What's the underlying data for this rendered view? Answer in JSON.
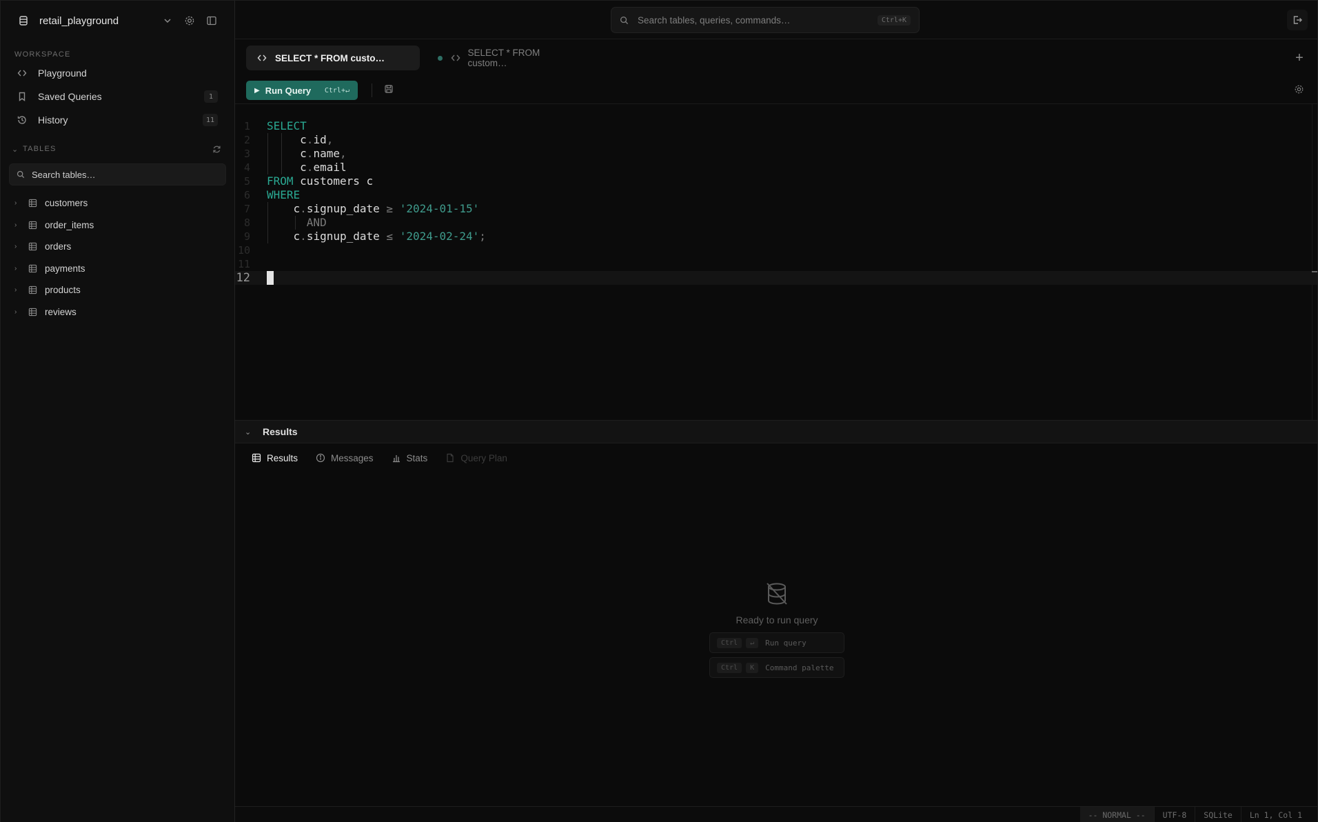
{
  "sidebar": {
    "database_name": "retail_playground",
    "workspace_label": "WORKSPACE",
    "nav": [
      {
        "label": "Playground",
        "badge": ""
      },
      {
        "label": "Saved Queries",
        "badge": "1"
      },
      {
        "label": "History",
        "badge": "11"
      }
    ],
    "tables_label": "TABLES",
    "table_search_placeholder": "Search tables…",
    "tables": [
      "customers",
      "order_items",
      "orders",
      "payments",
      "products",
      "reviews"
    ]
  },
  "topbar": {
    "search_placeholder": "Search tables, queries, commands…",
    "search_shortcut": "Ctrl+K"
  },
  "tabs": [
    {
      "label": "SELECT * FROM custo…",
      "active": true
    },
    {
      "label": "SELECT * FROM custom…",
      "active": false,
      "unsaved": true
    }
  ],
  "toolbar": {
    "run_label": "Run Query",
    "run_shortcut": "Ctrl+↵"
  },
  "editor": {
    "lines": [
      {
        "n": "1",
        "tokens": [
          {
            "t": "SELECT",
            "c": "kw"
          }
        ]
      },
      {
        "n": "2",
        "tokens": [
          {
            "t": "     c",
            "c": ""
          },
          {
            "t": ".",
            "c": "op"
          },
          {
            "t": "id",
            "c": ""
          },
          {
            "t": ",",
            "c": "op"
          }
        ]
      },
      {
        "n": "3",
        "tokens": [
          {
            "t": "     c",
            "c": ""
          },
          {
            "t": ".",
            "c": "op"
          },
          {
            "t": "name",
            "c": ""
          },
          {
            "t": ",",
            "c": "op"
          }
        ]
      },
      {
        "n": "4",
        "tokens": [
          {
            "t": "     c",
            "c": ""
          },
          {
            "t": ".",
            "c": "op"
          },
          {
            "t": "email",
            "c": ""
          }
        ]
      },
      {
        "n": "5",
        "tokens": [
          {
            "t": "FROM",
            "c": "kw"
          },
          {
            "t": " customers c",
            "c": ""
          }
        ]
      },
      {
        "n": "6",
        "tokens": [
          {
            "t": "WHERE",
            "c": "kw"
          }
        ]
      },
      {
        "n": "7",
        "tokens": [
          {
            "t": "    c",
            "c": ""
          },
          {
            "t": ".",
            "c": "op"
          },
          {
            "t": "signup_date ",
            "c": ""
          },
          {
            "t": "≥",
            "c": "op"
          },
          {
            "t": " ",
            "c": ""
          },
          {
            "t": "'2024-01-15'",
            "c": "str"
          }
        ]
      },
      {
        "n": "8",
        "tokens": [
          {
            "t": "      AND",
            "c": "op"
          }
        ]
      },
      {
        "n": "9",
        "tokens": [
          {
            "t": "    c",
            "c": ""
          },
          {
            "t": ".",
            "c": "op"
          },
          {
            "t": "signup_date ",
            "c": ""
          },
          {
            "t": "≤",
            "c": "op"
          },
          {
            "t": " ",
            "c": ""
          },
          {
            "t": "'2024-02-24'",
            "c": "str"
          },
          {
            "t": ";",
            "c": "op"
          }
        ]
      },
      {
        "n": "10",
        "tokens": []
      },
      {
        "n": "11",
        "tokens": []
      },
      {
        "n": "12",
        "tokens": [],
        "current": true
      }
    ]
  },
  "results": {
    "header": "Results",
    "tabs": [
      {
        "label": "Results",
        "state": "active",
        "icon": "table-icon"
      },
      {
        "label": "Messages",
        "state": "normal",
        "icon": "info-icon"
      },
      {
        "label": "Stats",
        "state": "normal",
        "icon": "bar-chart-icon"
      },
      {
        "label": "Query Plan",
        "state": "disabled",
        "icon": "document-icon"
      }
    ],
    "empty_message": "Ready to run query",
    "shortcuts": [
      {
        "keys": [
          "Ctrl",
          "↵"
        ],
        "desc": "Run query"
      },
      {
        "keys": [
          "Ctrl",
          "K"
        ],
        "desc": "Command palette"
      }
    ]
  },
  "statusbar": {
    "mode": "-- NORMAL --",
    "encoding": "UTF-8",
    "dialect": "SQLite",
    "position": "Ln 1, Col 1"
  },
  "colors": {
    "accent": "#1f6a5d",
    "keyword": "#2aa892",
    "string": "#3f9b8c",
    "background": "#0b0b0b"
  }
}
